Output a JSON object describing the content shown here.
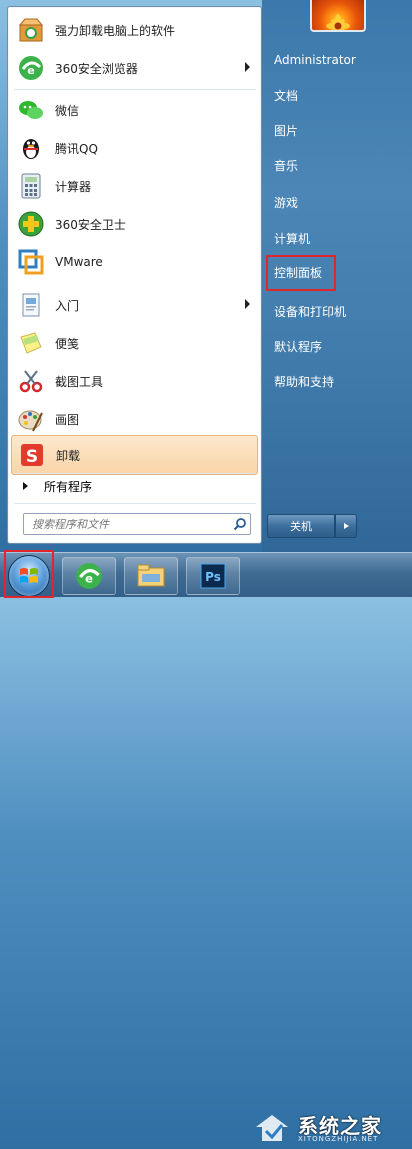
{
  "left_menu": {
    "items": [
      {
        "label": "强力卸载电脑上的软件",
        "icon": "uninstall-box-icon",
        "has_arrow": false
      },
      {
        "label": "360安全浏览器",
        "icon": "360-browser-icon",
        "has_arrow": true
      },
      {
        "label": "微信",
        "icon": "wechat-icon",
        "has_arrow": false
      },
      {
        "label": "腾讯QQ",
        "icon": "qq-penguin-icon",
        "has_arrow": false
      },
      {
        "label": "计算器",
        "icon": "calculator-icon",
        "has_arrow": false
      },
      {
        "label": "360安全卫士",
        "icon": "360-safeguard-icon",
        "has_arrow": false
      },
      {
        "label": "VMware",
        "icon": "vmware-icon",
        "has_arrow": false
      },
      {
        "label": "入门",
        "icon": "getting-started-icon",
        "has_arrow": true
      },
      {
        "label": "便笺",
        "icon": "sticky-notes-icon",
        "has_arrow": false
      },
      {
        "label": "截图工具",
        "icon": "snipping-tool-icon",
        "has_arrow": false
      },
      {
        "label": "画图",
        "icon": "paint-icon",
        "has_arrow": false
      },
      {
        "label": "卸载",
        "icon": "uninstall-s-icon",
        "has_arrow": false
      }
    ],
    "all_programs": "所有程序"
  },
  "search": {
    "placeholder": "搜索程序和文件"
  },
  "right_menu": {
    "items": [
      {
        "label": "Administrator"
      },
      {
        "label": "文档"
      },
      {
        "label": "图片"
      },
      {
        "label": "音乐"
      },
      {
        "label": "游戏"
      },
      {
        "label": "计算机"
      },
      {
        "label": "控制面板"
      },
      {
        "label": "设备和打印机"
      },
      {
        "label": "默认程序"
      },
      {
        "label": "帮助和支持"
      }
    ]
  },
  "shutdown": {
    "label": "关机"
  },
  "watermark": {
    "text": "系统之家",
    "url": "XITONGZHIJIA.NET"
  },
  "colors": {
    "highlight_box": "#e0262b",
    "hovered_item_bg": "#fde8ce",
    "right_pane_bg": "#3f7aac"
  }
}
